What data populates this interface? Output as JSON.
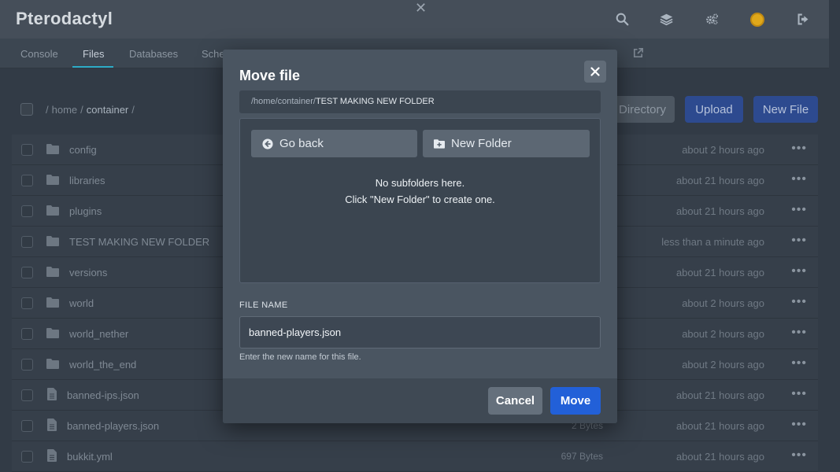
{
  "app": {
    "brand": "Pterodactyl"
  },
  "topbar": {
    "icons": [
      "search-icon",
      "layers-icon",
      "cogs-icon",
      "avatar",
      "sign-out-icon"
    ]
  },
  "subnav": {
    "tabs": [
      {
        "label": "Console"
      },
      {
        "label": "Files",
        "active": true
      },
      {
        "label": "Databases"
      },
      {
        "label": "Sche"
      }
    ]
  },
  "breadcrumb": {
    "sep": "/",
    "home": "home",
    "container": "container"
  },
  "actions": {
    "directory": "Directory",
    "upload": "Upload",
    "new_file": "New File"
  },
  "files": [
    {
      "name": "config",
      "type": "folder",
      "size": "",
      "time": "about 2 hours ago"
    },
    {
      "name": "libraries",
      "type": "folder",
      "size": "",
      "time": "about 21 hours ago"
    },
    {
      "name": "plugins",
      "type": "folder",
      "size": "",
      "time": "about 21 hours ago"
    },
    {
      "name": "TEST MAKING NEW FOLDER",
      "type": "folder",
      "size": "",
      "time": "less than a minute ago"
    },
    {
      "name": "versions",
      "type": "folder",
      "size": "",
      "time": "about 21 hours ago"
    },
    {
      "name": "world",
      "type": "folder",
      "size": "",
      "time": "about 2 hours ago"
    },
    {
      "name": "world_nether",
      "type": "folder",
      "size": "",
      "time": "about 2 hours ago"
    },
    {
      "name": "world_the_end",
      "type": "folder",
      "size": "",
      "time": "about 2 hours ago"
    },
    {
      "name": "banned-ips.json",
      "type": "file",
      "size": "",
      "time": "about 21 hours ago"
    },
    {
      "name": "banned-players.json",
      "type": "file",
      "size": "2 Bytes",
      "time": "about 21 hours ago"
    },
    {
      "name": "bukkit.yml",
      "type": "file",
      "size": "697 Bytes",
      "time": "about 21 hours ago"
    }
  ],
  "modal": {
    "title": "Move file",
    "path_prefix": "/home/container/",
    "path_current": "TEST MAKING NEW FOLDER",
    "go_back": "Go back",
    "new_folder": "New Folder",
    "empty_line1": "No subfolders here.",
    "empty_line2": "Click \"New Folder\" to create one.",
    "file_name_label": "FILE NAME",
    "file_name_value": "banned-players.json",
    "file_name_help": "Enter the new name for this file.",
    "cancel": "Cancel",
    "move": "Move"
  },
  "colors": {
    "accent": "#2260d8",
    "tab_underline": "#2dabc7"
  }
}
